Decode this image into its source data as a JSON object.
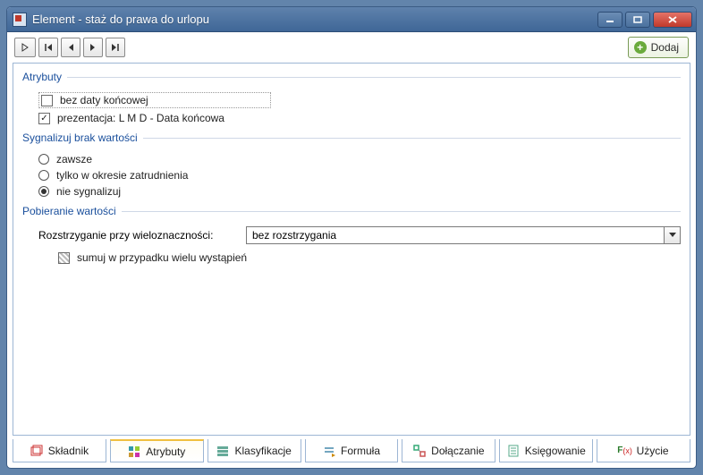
{
  "window": {
    "title": "Element - staż do prawa do urlopu"
  },
  "toolbar": {
    "add_label": "Dodaj"
  },
  "sections": {
    "attributes": {
      "title": "Atrybuty",
      "opt_no_end_date": "bez daty końcowej",
      "opt_presentation": "prezentacja: L M D - Data końcowa"
    },
    "signal": {
      "title": "Sygnalizuj brak wartości",
      "opt_always": "zawsze",
      "opt_employment": "tylko w okresie zatrudnienia",
      "opt_no_signal": "nie sygnalizuj"
    },
    "retrieval": {
      "title": "Pobieranie wartości",
      "ambiguity_label": "Rozstrzyganie przy wieloznaczności:",
      "ambiguity_value": "bez rozstrzygania",
      "sum_label": "sumuj w przypadku wielu wystąpień"
    }
  },
  "tabs": {
    "component": "Składnik",
    "attributes": "Atrybuty",
    "classifications": "Klasyfikacje",
    "formula": "Formuła",
    "attaching": "Dołączanie",
    "booking": "Księgowanie",
    "usage": "Użycie"
  }
}
